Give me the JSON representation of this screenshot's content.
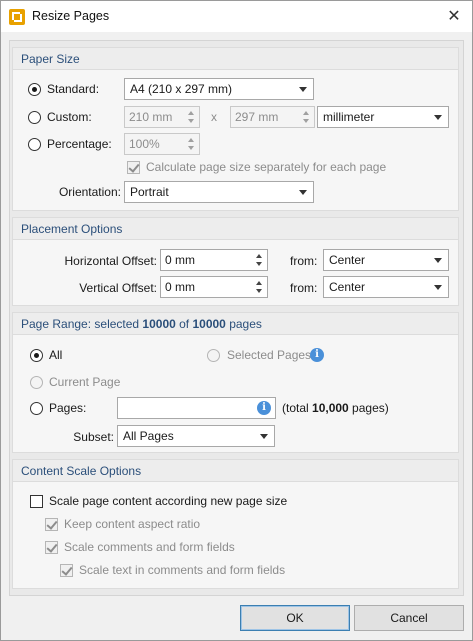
{
  "window": {
    "title": "Resize Pages",
    "close_glyph": "✕"
  },
  "paper_size": {
    "header": "Paper Size",
    "standard": {
      "label": "Standard:",
      "value": "A4 (210 x 297 mm)"
    },
    "custom": {
      "label": "Custom:",
      "width": "210 mm",
      "separator": "x",
      "height": "297 mm",
      "unit": "millimeter"
    },
    "percentage": {
      "label": "Percentage:",
      "value": "100%"
    },
    "calc_separately": "Calculate page size separately for each page",
    "orientation": {
      "label": "Orientation:",
      "value": "Portrait"
    }
  },
  "placement": {
    "header": "Placement Options",
    "horizontal": {
      "label": "Horizontal Offset:",
      "value": "0 mm",
      "from_label": "from:",
      "from_value": "Center"
    },
    "vertical": {
      "label": "Vertical Offset:",
      "value": "0 mm",
      "from_label": "from:",
      "from_value": "Center"
    }
  },
  "page_range": {
    "header_prefix": "Page Range: selected ",
    "selected": "10000",
    "header_mid": " of ",
    "total": "10000",
    "header_suffix": " pages",
    "all": "All",
    "selected_pages": "Selected Pages",
    "current_page": "Current Page",
    "pages": {
      "label": "Pages:",
      "value": "",
      "total_prefix": "(total ",
      "total_value": "10,000",
      "total_suffix": " pages)"
    },
    "subset": {
      "label": "Subset:",
      "value": "All Pages"
    }
  },
  "content_scale": {
    "header": "Content Scale Options",
    "scale_content": "Scale page content according new page size",
    "keep_aspect": "Keep content aspect ratio",
    "scale_comments": "Scale comments and form fields",
    "scale_text": "Scale text in comments and form fields"
  },
  "buttons": {
    "ok": "OK",
    "cancel": "Cancel"
  },
  "colors": {
    "accent": "#2b4f7a",
    "info": "#4a90d9",
    "app_icon": "#e8a100"
  }
}
